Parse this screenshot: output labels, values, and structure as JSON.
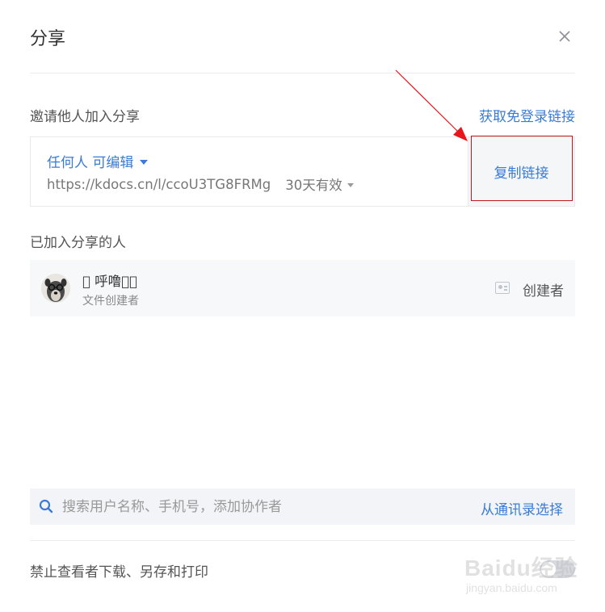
{
  "dialog": {
    "title": "分享"
  },
  "invite": {
    "label": "邀请他人加入分享",
    "no_login_link": "获取免登录链接",
    "permission": "任何人 可编辑",
    "url": "https://kdocs.cn/l/ccoU3TG8FRMg",
    "validity": "30天有效",
    "copy_button": "复制链接"
  },
  "members": {
    "label": "已加入分享的人",
    "items": [
      {
        "name": "⃟ 呼噜娃⃟",
        "subtitle": "文件创建者",
        "role": "创建者"
      }
    ]
  },
  "search": {
    "placeholder": "搜索用户名称、手机号，添加协作者",
    "contacts_link": "从通讯录选择"
  },
  "restrict": {
    "label": "禁止查看者下载、另存和打印",
    "enabled": false
  },
  "watermark": {
    "main": "Baidu经验",
    "sub": "jingyan.baidu.com"
  },
  "colors": {
    "accent": "#3a7bd5",
    "annotation": "#c8161d",
    "row_bg": "#f7f8fa"
  }
}
